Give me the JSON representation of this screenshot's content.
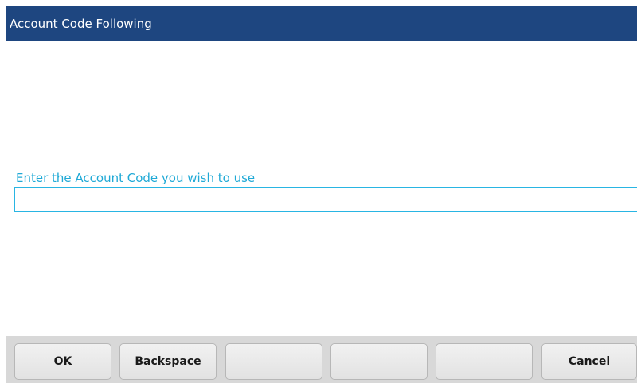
{
  "window": {
    "title": "Account Code Following"
  },
  "form": {
    "prompt": "Enter the Account Code you wish to use",
    "value": ""
  },
  "softkeys": [
    {
      "label": "OK"
    },
    {
      "label": "Backspace"
    },
    {
      "label": ""
    },
    {
      "label": ""
    },
    {
      "label": ""
    },
    {
      "label": "Cancel"
    }
  ],
  "colors": {
    "title_bar": "#1e4680",
    "prompt_text": "#1fa9d6",
    "input_border": "#29b5e3",
    "softkey_bar": "#d8d8d8"
  }
}
